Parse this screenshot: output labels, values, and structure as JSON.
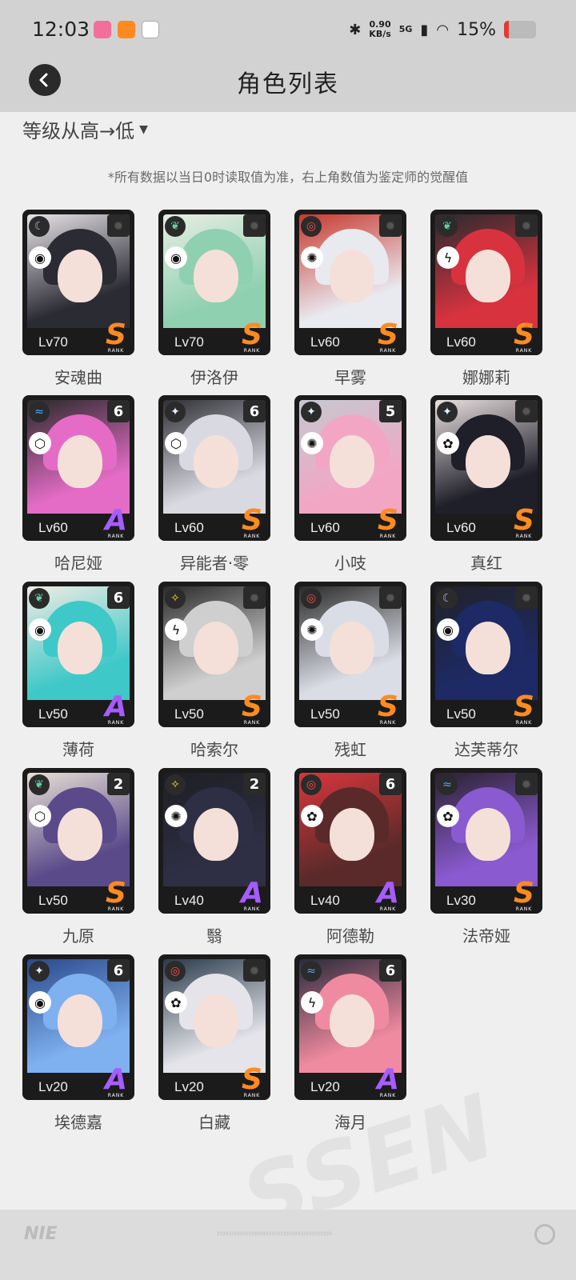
{
  "status_bar": {
    "time": "12:03",
    "network_speed_value": "0.90",
    "network_speed_unit": "KB/s",
    "signal_label": "5G",
    "battery_percent": "15%",
    "battery_level": 0.15
  },
  "header": {
    "title": "角色列表",
    "sort_label": "等级从高→低"
  },
  "note": "*所有数据以当日0时读取值为准，右上角数值为鉴定师的觉醒值",
  "colors": {
    "rank_s": "#ff8a1f",
    "rank_a": "#a65cff",
    "card_bg": "#1b1b1b",
    "battery_low": "#e53935"
  },
  "characters": [
    {
      "name": "安魂曲",
      "level": "Lv70",
      "rank": "S",
      "rank_sub": "RANK",
      "awaken": "",
      "element": "moon",
      "type": "swirl",
      "palette": [
        "#2b2b33",
        "#e9e4ea"
      ]
    },
    {
      "name": "伊洛伊",
      "level": "Lv70",
      "rank": "S",
      "rank_sub": "RANK",
      "awaken": "",
      "element": "leaf",
      "type": "swirl",
      "palette": [
        "#8fd0b0",
        "#e7ede4"
      ]
    },
    {
      "name": "早雾",
      "level": "Lv60",
      "rank": "S",
      "rank_sub": "RANK",
      "awaken": "",
      "element": "fire",
      "type": "vortex",
      "palette": [
        "#e9e9f0",
        "#c8382f"
      ]
    },
    {
      "name": "娜娜莉",
      "level": "Lv60",
      "rank": "S",
      "rank_sub": "RANK",
      "awaken": "",
      "element": "leaf",
      "type": "bolt",
      "palette": [
        "#d8323f",
        "#2a2a2e"
      ]
    },
    {
      "name": "哈尼娅",
      "level": "Lv60",
      "rank": "A",
      "rank_sub": "RANK",
      "awaken": "6",
      "element": "water",
      "type": "cube",
      "palette": [
        "#e46cc6",
        "#2a2a2a"
      ]
    },
    {
      "name": "异能者·零",
      "level": "Lv60",
      "rank": "S",
      "rank_sub": "RANK",
      "awaken": "6",
      "element": "light",
      "type": "cube",
      "palette": [
        "#d9d9e2",
        "#303036"
      ]
    },
    {
      "name": "小吱",
      "level": "Lv60",
      "rank": "S",
      "rank_sub": "RANK",
      "awaken": "5",
      "element": "light",
      "type": "vortex",
      "palette": [
        "#f2a6c4",
        "#c5c8cf"
      ]
    },
    {
      "name": "真红",
      "level": "Lv60",
      "rank": "S",
      "rank_sub": "RANK",
      "awaken": "",
      "element": "light",
      "type": "gear",
      "palette": [
        "#1f1f2a",
        "#e9e0e0"
      ]
    },
    {
      "name": "薄荷",
      "level": "Lv50",
      "rank": "A",
      "rank_sub": "RANK",
      "awaken": "6",
      "element": "leaf",
      "type": "swirl",
      "palette": [
        "#3fc8c8",
        "#f0ece4"
      ]
    },
    {
      "name": "哈索尔",
      "level": "Lv50",
      "rank": "S",
      "rank_sub": "RANK",
      "awaken": "",
      "element": "star",
      "type": "bolt",
      "palette": [
        "#cfcfcf",
        "#2b2b2b"
      ]
    },
    {
      "name": "残虹",
      "level": "Lv50",
      "rank": "S",
      "rank_sub": "RANK",
      "awaken": "",
      "element": "fire",
      "type": "vortex",
      "palette": [
        "#dadde6",
        "#2b2b2b"
      ]
    },
    {
      "name": "达芙蒂尔",
      "level": "Lv50",
      "rank": "S",
      "rank_sub": "RANK",
      "awaken": "",
      "element": "moon",
      "type": "swirl",
      "palette": [
        "#1d2a66",
        "#222229"
      ]
    },
    {
      "name": "九原",
      "level": "Lv50",
      "rank": "S",
      "rank_sub": "RANK",
      "awaken": "2",
      "element": "leaf",
      "type": "cube",
      "palette": [
        "#5a4a8a",
        "#e6e0d4"
      ]
    },
    {
      "name": "翳",
      "level": "Lv40",
      "rank": "A",
      "rank_sub": "RANK",
      "awaken": "2",
      "element": "star",
      "type": "vortex",
      "palette": [
        "#2e2f44",
        "#1e1e24"
      ]
    },
    {
      "name": "阿德勒",
      "level": "Lv40",
      "rank": "A",
      "rank_sub": "RANK",
      "awaken": "6",
      "element": "fire",
      "type": "gear",
      "palette": [
        "#5a2a2a",
        "#d8363c"
      ]
    },
    {
      "name": "法帝娅",
      "level": "Lv30",
      "rank": "S",
      "rank_sub": "RANK",
      "awaken": "",
      "element": "water",
      "type": "gear",
      "palette": [
        "#8a5ad0",
        "#2a2232"
      ]
    },
    {
      "name": "埃德嘉",
      "level": "Lv20",
      "rank": "A",
      "rank_sub": "RANK",
      "awaken": "6",
      "element": "light",
      "type": "swirl",
      "palette": [
        "#7fb0f0",
        "#2b4a8a"
      ]
    },
    {
      "name": "白藏",
      "level": "Lv20",
      "rank": "S",
      "rank_sub": "RANK",
      "awaken": "",
      "element": "fire",
      "type": "gear",
      "palette": [
        "#e4e4ea",
        "#2a3a4a"
      ]
    },
    {
      "name": "海月",
      "level": "Lv20",
      "rank": "A",
      "rank_sub": "RANK",
      "awaken": "6",
      "element": "water",
      "type": "bolt",
      "palette": [
        "#f08aa0",
        "#2b2b3a"
      ]
    }
  ],
  "footer": {
    "brand_mark": "NIE"
  }
}
